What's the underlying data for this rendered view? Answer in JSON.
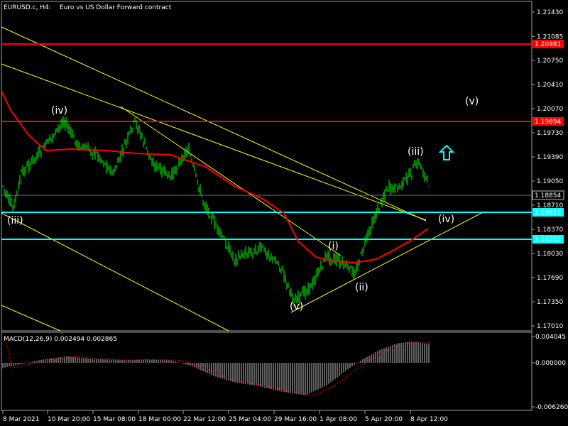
{
  "header": {
    "symbol": "EURUSD.c, H4:",
    "description": "Euro vs US Dollar Forward contract"
  },
  "chart_data": {
    "type": "candlestick",
    "price_axis": {
      "ticks": [
        "1.21430",
        "1.21085",
        "1.20750",
        "1.20410",
        "1.20070",
        "1.19730",
        "1.19390",
        "1.19050",
        "1.18710",
        "1.18370",
        "1.18030",
        "1.17690",
        "1.17350",
        "1.17010"
      ],
      "range": [
        1.1682,
        1.2162
      ]
    },
    "time_axis": {
      "labels": [
        "8 Mar 2021",
        "10 Mar 20:00",
        "15 Mar 08:00",
        "18 Mar 00:00",
        "22 Mar 12:00",
        "25 Mar 04:00",
        "29 Mar 16:00",
        "1 Apr 08:00",
        "5 Apr 20:00",
        "8 Apr 12:00"
      ]
    },
    "horizontal_levels": [
      {
        "price": 1.2098,
        "label": "1.20981",
        "color": "#ff0000"
      },
      {
        "price": 1.1989,
        "label": "1.19894",
        "color": "#ff0000"
      },
      {
        "price": 1.1861,
        "label": "1.18612",
        "color": "#00ffff"
      },
      {
        "price": 1.1823,
        "label": "1.18231",
        "color": "#00ffff"
      }
    ],
    "current_price": {
      "price": 1.1885,
      "label": "1.18854",
      "color": "#c0c0c0"
    },
    "wave_labels": [
      "(iv)",
      "(iii)",
      "(v)",
      "(i)",
      "(ii)",
      "(iii)",
      "(iv)",
      "(v)"
    ],
    "moving_average_color": "#ff0000",
    "candle_color": "#00ff00",
    "trendline_color": "#ffff00",
    "arrow": {
      "direction": "up",
      "color": "#00ffff"
    },
    "macd": {
      "label": "MACD(12,26,9) 0.002494 0.002865",
      "ticks": [
        "0.004045",
        "0.000000",
        "-0.006260"
      ],
      "histogram_color": "#c0c0c0",
      "signal_color": "#ff0000"
    }
  }
}
